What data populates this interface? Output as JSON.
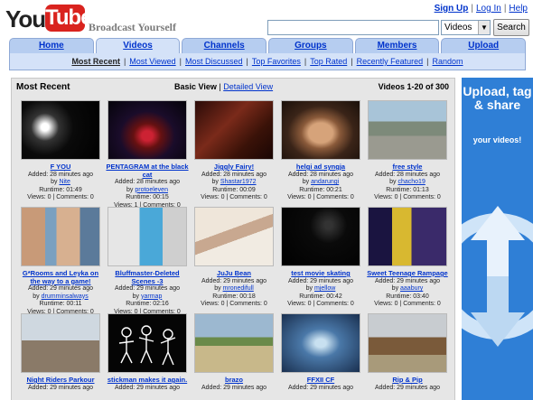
{
  "header": {
    "logo_you": "You",
    "logo_tube": "Tube",
    "tagline": "Broadcast Yourself",
    "links": [
      "Sign Up",
      "Log In",
      "Help"
    ],
    "search": {
      "value": "",
      "category": "Videos",
      "button": "Search"
    }
  },
  "tabs": [
    "Home",
    "Videos",
    "Channels",
    "Groups",
    "Members",
    "Upload"
  ],
  "subnav": [
    "Most Recent",
    "Most Viewed",
    "Most Discussed",
    "Top Favorites",
    "Top Rated",
    "Recently Featured",
    "Random"
  ],
  "panel": {
    "title": "Most Recent",
    "basic_view": "Basic View",
    "detailed_view": "Detailed View",
    "count": "Videos 1-20 of 300"
  },
  "videos": [
    {
      "title": "F YOU",
      "added": "Added: 28 minutes ago",
      "by": "Nite",
      "runtime": "Runtime: 01:49",
      "views": "Views: 0 | Comments: 0"
    },
    {
      "title": "PENTAGRAM at the black cat",
      "added": "Added: 28 minutes ago",
      "by": "protoeleven",
      "runtime": "Runtime: 00:15",
      "views": "Views: 1 | Comments: 0"
    },
    {
      "title": "Jiggly Fairy!",
      "added": "Added: 28 minutes ago",
      "by": "Shastar1972",
      "runtime": "Runtime: 00:09",
      "views": "Views: 0 | Comments: 0"
    },
    {
      "title": "helgi ad syngja",
      "added": "Added: 28 minutes ago",
      "by": "andarungi",
      "runtime": "Runtime: 00:21",
      "views": "Views: 0 | Comments: 0"
    },
    {
      "title": "free style",
      "added": "Added: 28 minutes ago",
      "by": "chacho19",
      "runtime": "Runtime: 01:13",
      "views": "Views: 0 | Comments: 0"
    },
    {
      "title": "G*Rooms and Leyka on the way to a game!",
      "added": "Added: 29 minutes ago",
      "by": "drumminsalways",
      "runtime": "Runtime: 00:11",
      "views": "Views: 0 | Comments: 0"
    },
    {
      "title": "Bluffmaster-Deleted Scenes -3",
      "added": "Added: 29 minutes ago",
      "by": "yarmap",
      "runtime": "Runtime: 02:16",
      "views": "Views: 0 | Comments: 0"
    },
    {
      "title": "JuJu Bean",
      "added": "Added: 29 minutes ago",
      "by": "mronedifull",
      "runtime": "Runtime: 00:18",
      "views": "Views: 0 | Comments: 0"
    },
    {
      "title": "test movie skating",
      "added": "Added: 29 minutes ago",
      "by": "mjellow",
      "runtime": "Runtime: 00:42",
      "views": "Views: 0 | Comments: 0"
    },
    {
      "title": "Sweet Teenage Rampage",
      "added": "Added: 29 minutes ago",
      "by": "aaabury",
      "runtime": "Runtime: 03:40",
      "views": "Views: 0 | Comments: 0"
    },
    {
      "title": "Night Riders Parkour",
      "added": "Added: 29 minutes ago",
      "by": "",
      "runtime": "",
      "views": ""
    },
    {
      "title": "stickman makes it again.",
      "added": "Added: 29 minutes ago",
      "by": "",
      "runtime": "",
      "views": ""
    },
    {
      "title": "brazo",
      "added": "Added: 29 minutes ago",
      "by": "",
      "runtime": "",
      "views": ""
    },
    {
      "title": "FFXII CF",
      "added": "Added: 29 minutes ago",
      "by": "",
      "runtime": "",
      "views": ""
    },
    {
      "title": "Rip & Pip",
      "added": "Added: 29 minutes ago",
      "by": "",
      "runtime": "",
      "views": ""
    }
  ],
  "ad": {
    "headline": "Upload, tag & share",
    "sub": "your videos!"
  },
  "colors": {
    "brand_red": "#d9231e",
    "tab_blue": "#b6cdf0",
    "link": "#0033cc",
    "ad_blue": "#2f7fd6"
  }
}
